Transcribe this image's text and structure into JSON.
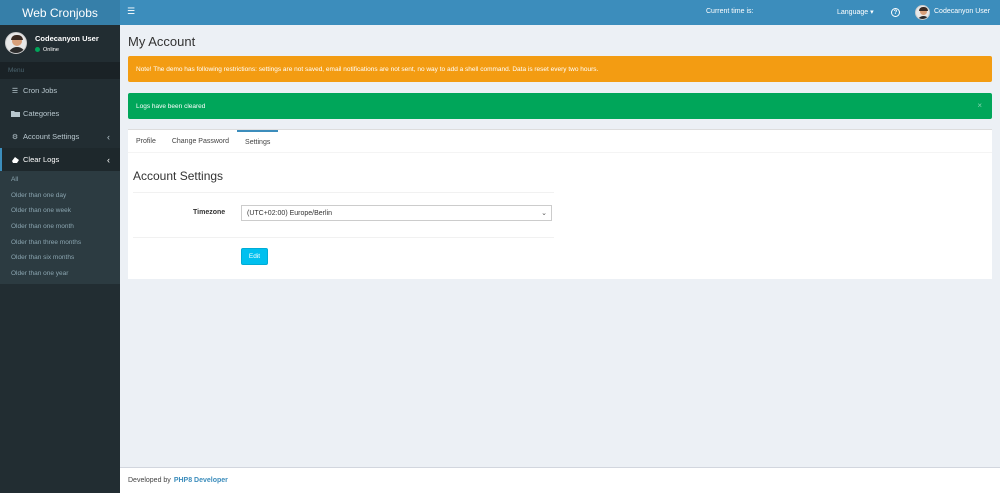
{
  "app": {
    "title": "Web Cronjobs"
  },
  "user": {
    "name": "Codecanyon User",
    "status": "Online"
  },
  "sidebar": {
    "menu_header": "Menu",
    "items": [
      {
        "label": "Cron Jobs",
        "icon": "list-icon"
      },
      {
        "label": "Categories",
        "icon": "folder-icon"
      },
      {
        "label": "Account Settings",
        "icon": "gears-icon"
      },
      {
        "label": "Clear Logs",
        "icon": "eraser-icon"
      }
    ],
    "clear_logs_sub": [
      "All",
      "Older than one day",
      "Older than one week",
      "Older than one month",
      "Older than three months",
      "Older than six months",
      "Older than one year"
    ]
  },
  "topbar": {
    "current_time_label": "Current time is:",
    "language_label": "Language",
    "user_name": "Codecanyon User"
  },
  "page": {
    "title": "My Account"
  },
  "alerts": {
    "warning": "Note! The demo has following restrictions: settings are not saved, email notifications are not sent, no way to add a shell command. Data is reset every two hours.",
    "success": "Logs have been cleared",
    "close": "×"
  },
  "tabs": [
    {
      "label": "Profile"
    },
    {
      "label": "Change Password"
    },
    {
      "label": "Settings"
    }
  ],
  "settings": {
    "section_title": "Account Settings",
    "timezone_label": "Timezone",
    "timezone_value": "(UTC+02:00) Europe/Berlin",
    "edit_button": "Edit"
  },
  "footer": {
    "text": "Developed by",
    "link": "PHP8 Developer"
  },
  "colors": {
    "brand": "#3c8dbc",
    "sidebar_bg": "#222d32",
    "warning": "#f39c12",
    "success": "#00a65a",
    "info": "#00c0ef"
  }
}
